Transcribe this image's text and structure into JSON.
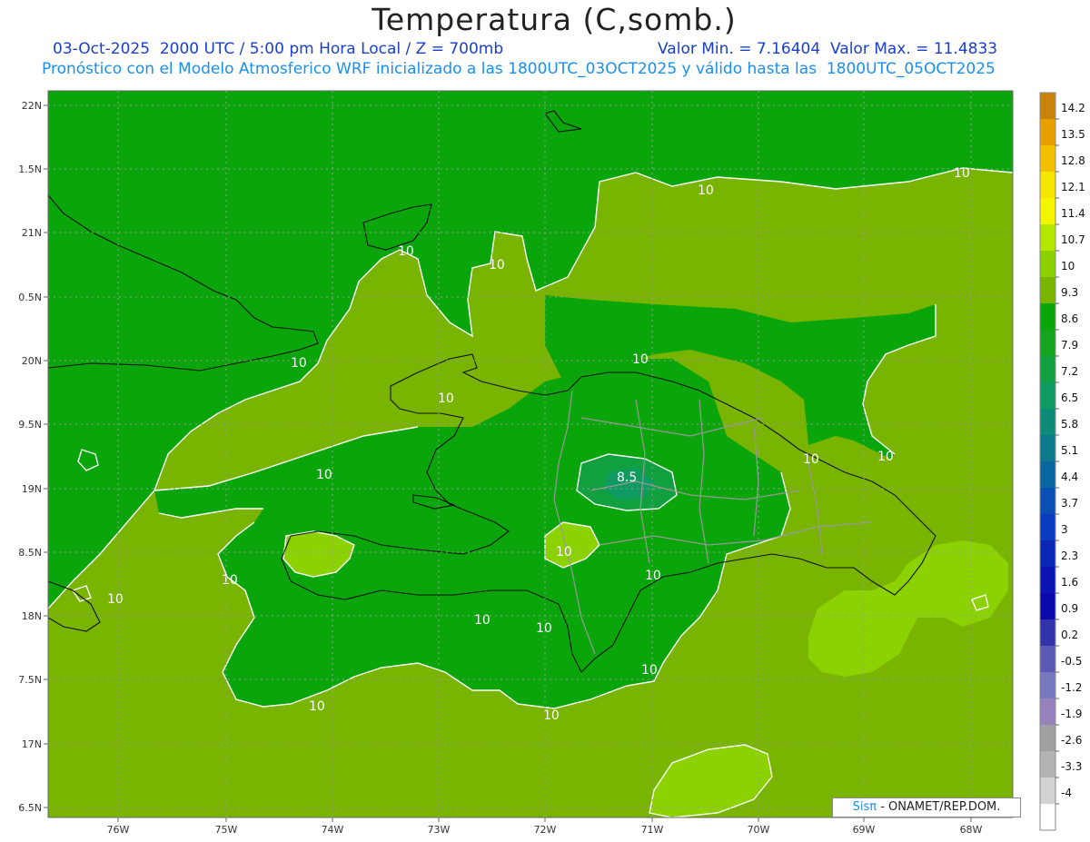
{
  "title": "Temperatura (C,somb.)",
  "subtitle_left": "03-Oct-2025  2000 UTC / 5:00 pm Hora Local / Z = 700mb",
  "subtitle_right": "Valor Min. = 7.16404  Valor Max. = 11.4833",
  "subtitle2": "Pronóstico con el Modelo Atmosferico WRF inicializado a las 1800UTC_03OCT2025 y válido hasta las  1800UTC_05OCT2025",
  "lat_labels": [
    "22N",
    "1.5N",
    "21N",
    "0.5N",
    "20N",
    "9.5N",
    "19N",
    "8.5N",
    "18N",
    "7.5N",
    "17N",
    "6.5N"
  ],
  "lon_labels": [
    "76W",
    "75W",
    "74W",
    "73W",
    "72W",
    "71W",
    "70W",
    "69W",
    "68W"
  ],
  "colorbar": {
    "levels": [
      "14.2",
      "13.5",
      "12.8",
      "12.1",
      "11.4",
      "10.7",
      "10",
      "9.3",
      "8.6",
      "7.9",
      "7.2",
      "6.5",
      "5.8",
      "5.1",
      "4.4",
      "3.7",
      "3",
      "2.3",
      "1.6",
      "0.9",
      "0.2",
      "-0.5",
      "-1.2",
      "-1.9",
      "-2.6",
      "-3.3",
      "-4"
    ],
    "colors": [
      "#c8840a",
      "#e8a000",
      "#f5c000",
      "#f5e600",
      "#f5f500",
      "#b4e600",
      "#8cd200",
      "#78b400",
      "#0aa50a",
      "#14a41e",
      "#10a040",
      "#0e9a60",
      "#0e8a78",
      "#0c7a8c",
      "#0a66a0",
      "#0a50b4",
      "#0a3cc0",
      "#0a28b4",
      "#0a14b4",
      "#0a0aaa",
      "#3232aa",
      "#5a5ab4",
      "#7878c0",
      "#9682bc",
      "#a0a0a0",
      "#b4b4b4",
      "#d2d2d2",
      "#ffffff"
    ]
  },
  "contour_labels": [
    "10",
    "10",
    "10",
    "10",
    "10",
    "10",
    "10",
    "10",
    "10",
    "10",
    "10",
    "10",
    "10",
    "10",
    "10",
    "10",
    "10",
    "10",
    "8.5"
  ],
  "credit": {
    "sis": "Sisπ",
    "rest": " - ONAMET/REP.DOM."
  },
  "colors": {
    "base_green": "#78b400",
    "dark_green": "#0aa50a",
    "light_green": "#8cd200",
    "contour": "#ffffff"
  }
}
